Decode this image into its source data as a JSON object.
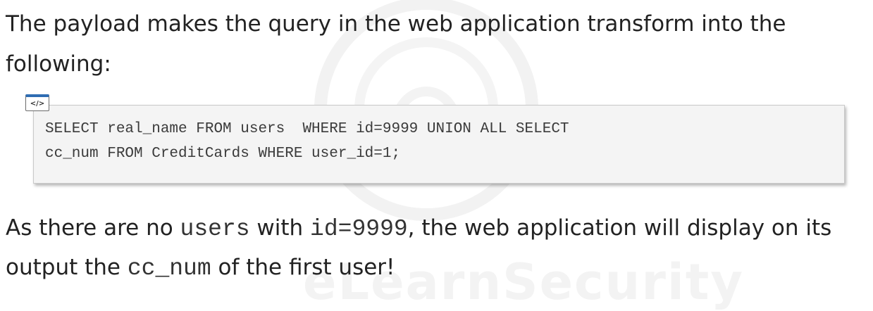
{
  "intro_text": "The payload makes the query in the web application transform into the following:",
  "code_icon_label": "</>",
  "code": {
    "line1": "SELECT real_name FROM users  WHERE id=9999 UNION ALL SELECT",
    "line2": "cc_num FROM CreditCards WHERE user_id=1;"
  },
  "outro": {
    "part1": "As there are no ",
    "code1": "users",
    "part2": " with ",
    "code2": "id=9999",
    "part3": ", the web application will display on its output the ",
    "code3": "cc_num",
    "part4": " of the first user!"
  },
  "icons": {
    "code_icon": "code-snippet-icon",
    "watermark": "elearnsecurity-watermark-logo"
  },
  "colors": {
    "text": "#222222",
    "code_background": "#f4f4f4",
    "code_icon_accent": "#2f6db3"
  }
}
